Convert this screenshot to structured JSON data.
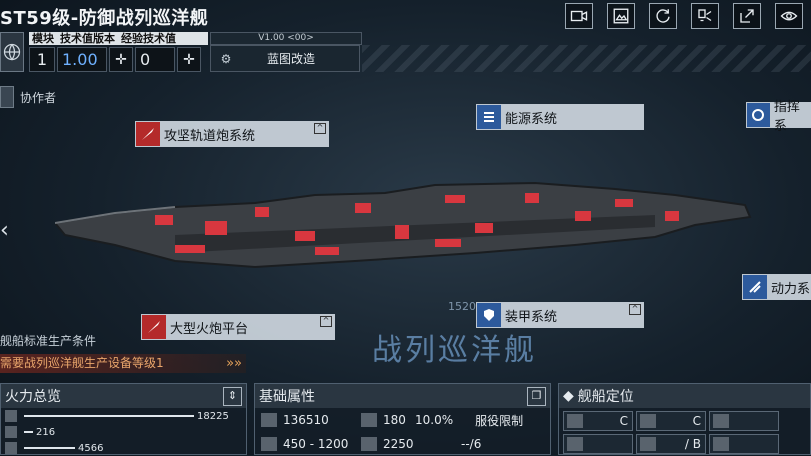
{
  "header": {
    "title": "ST59级-防御战列巡洋舰"
  },
  "toolbar": {
    "icons": [
      "video-icon",
      "gallery-icon",
      "refresh-icon",
      "screen-toggle-icon",
      "export-icon",
      "view-icon"
    ]
  },
  "stats": {
    "labels": [
      "模块",
      "技术值版本",
      "经验技术值"
    ],
    "module_value": "1",
    "tech_version_value": "1.00",
    "exp_tech_value": "0"
  },
  "version": "V1.00 <00>",
  "refit_label": "蓝图改造",
  "collaborator_label": "协作者",
  "systems": {
    "railgun": "攻坚轨道炮系统",
    "energy": "能源系统",
    "command": "指挥系",
    "power": "动力系",
    "artillery": "大型火炮平台",
    "armor": "装甲系统"
  },
  "ship_type_label": "战列巡洋舰",
  "coord_text": "1520",
  "production": {
    "condition": "舰船标准生产条件",
    "requirement": "需要战列巡洋舰生产设备等级1"
  },
  "firepower": {
    "title": "火力总览",
    "rows": [
      {
        "value": "18225",
        "fill": 1.0
      },
      {
        "value": "216",
        "fill": 0.05
      },
      {
        "value": "4566",
        "fill": 0.3
      }
    ]
  },
  "attributes": {
    "title": "基础属性",
    "hp": "136510",
    "armor": "180",
    "percent": "10.0%",
    "range": "450 - 1200",
    "speed": "2250",
    "service_label": "服役限制",
    "service_value": "--/6"
  },
  "positioning": {
    "title": "舰船定位",
    "cells": [
      {
        "grade": "C"
      },
      {
        "grade": "C"
      },
      {
        "grade": ""
      },
      {
        "grade": ""
      },
      {
        "grade": "/ B"
      },
      {
        "grade": ""
      }
    ]
  },
  "colors": {
    "accent": "#6f9bc8",
    "warning": "#e9a56b",
    "weapon": "#b42a2a",
    "ship_red": "#d8373f"
  }
}
